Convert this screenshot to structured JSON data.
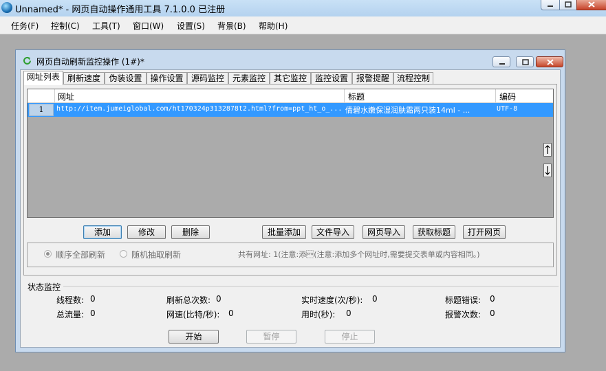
{
  "window": {
    "title": "Unnamed* - 网页自动操作通用工具 7.1.0.0  已注册"
  },
  "menu": [
    "任务(F)",
    "控制(C)",
    "工具(T)",
    "窗口(W)",
    "设置(S)",
    "背景(B)",
    "帮助(H)"
  ],
  "child": {
    "title": "网页自动刷新监控操作  (1#)*"
  },
  "tabs": [
    "网址列表",
    "刷新速度",
    "伪装设置",
    "操作设置",
    "源码监控",
    "元素监控",
    "其它监控",
    "监控设置",
    "报警提醒",
    "流程控制"
  ],
  "grid": {
    "columns": [
      "网址",
      "标题",
      "编码"
    ],
    "rows": [
      {
        "num": "1",
        "url": "http://item.jumeiglobal.com/ht170324p3132878t2.html?from=ppt_ht_o_...",
        "title": "倩碧水嫩保湿润肤霜两只装14ml - ...",
        "encoding": "UTF-8"
      }
    ]
  },
  "buttons": {
    "add": "添加",
    "edit": "修改",
    "delete": "删除",
    "batch_add": "批量添加",
    "import_file": "文件导入",
    "import_web": "网页导入",
    "get_title": "获取标题",
    "open_page": "打开网页"
  },
  "options": {
    "sequential": "顺序全部刷新",
    "random": "随机抽取刷新",
    "info": "共有网址:  1(注意:添\u0002(注意:添加多个网址时,需要提交表单或内容相同。)"
  },
  "status": {
    "title": "状态监控",
    "threads_label": "线程数:",
    "threads": "0",
    "total_refresh_label": "刷新总次数:",
    "total_refresh": "0",
    "speed_label": "实时速度(次/秒):",
    "speed": "0",
    "title_errors_label": "标题错误:",
    "title_errors": "0",
    "traffic_label": "总流量:",
    "traffic": "0",
    "net_speed_label": "网速(比特/秒):",
    "net_speed": "0",
    "elapsed_label": "用时(秒):",
    "elapsed": "0",
    "alarms_label": "报警次数:",
    "alarms": "0"
  },
  "controls": {
    "start": "开始",
    "pause": "暂停",
    "stop": "停止"
  }
}
